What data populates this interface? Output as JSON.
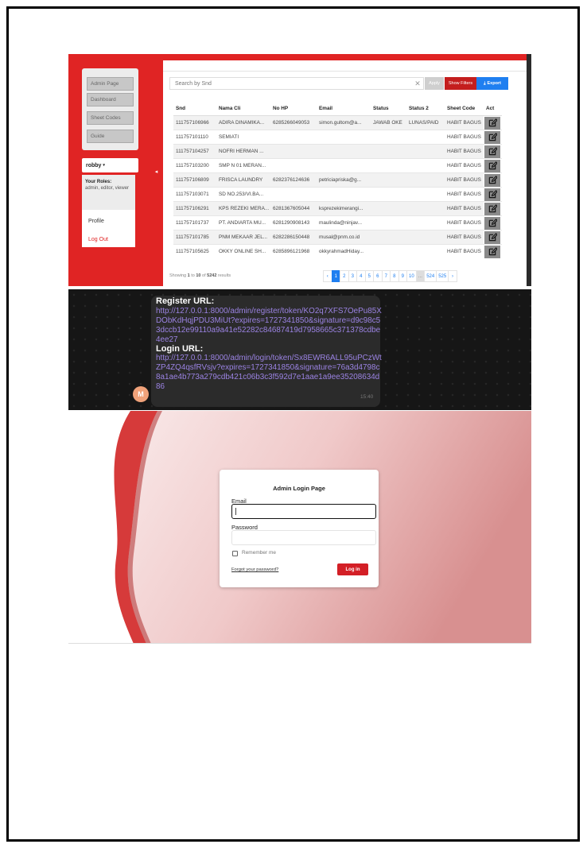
{
  "admin": {
    "sidebar": {
      "items": [
        "Admin Page",
        "Dashboard",
        "Sheet Codes",
        "Guide"
      ],
      "user": "robby",
      "user_caret": "▾",
      "roles_label": "Your Roles:",
      "roles_value": "admin, editor, viewer",
      "menu": [
        "Profile",
        "Log Out"
      ],
      "collapse_icon": "◂"
    },
    "toolbar": {
      "search_placeholder": "Search by Snd",
      "clear_icon": "✕",
      "apply": "Apply",
      "show_filters": "Show Filters",
      "export_icon": "⤓",
      "export": "Export"
    },
    "table": {
      "columns": [
        "Snd",
        "Nama Cli",
        "No HP",
        "Email",
        "Status",
        "Status 2",
        "Sheet Code",
        "Act"
      ],
      "rows": [
        [
          "111757106966",
          "ADIRA DINAMIKA...",
          "6285266049053",
          "simon.gultom@a...",
          "JAWAB OKE",
          "LUNAS/PAID",
          "HABIT BAGUS"
        ],
        [
          "111757101110",
          "SEMIATI",
          "",
          "",
          "",
          "",
          "HABIT BAGUS"
        ],
        [
          "111757104257",
          "NOFRI HERMAN ...",
          "",
          "",
          "",
          "",
          "HABIT BAGUS"
        ],
        [
          "111757103200",
          "SMP N 01 MERAN...",
          "",
          "",
          "",
          "",
          "HABIT BAGUS"
        ],
        [
          "111757106809",
          "FRISCA LAUNDRY",
          "6282376124636",
          "petriciapriska@g...",
          "",
          "",
          "HABIT BAGUS"
        ],
        [
          "111757103071",
          "SD NO.253/VI.BA...",
          "",
          "",
          "",
          "",
          "HABIT BAGUS"
        ],
        [
          "111757106291",
          "KPS REZEKI MERA...",
          "6281367605044",
          "ksprezekimerangi...",
          "",
          "",
          "HABIT BAGUS"
        ],
        [
          "111757101737",
          "PT. ANDIARTA MU...",
          "6281290908143",
          "maulinda@ninjav...",
          "",
          "",
          "HABIT BAGUS"
        ],
        [
          "111757101785",
          "PNM MEKAAR JEL...",
          "6282286150448",
          "musal@pnm.co.id",
          "",
          "",
          "HABIT BAGUS"
        ],
        [
          "111757105625",
          "OKKY ONLINE SH...",
          "6285896121968",
          "okkyrahmadHiday...",
          "",
          "",
          "HABIT BAGUS"
        ]
      ]
    },
    "footer": {
      "prefix": "Showing ",
      "from": "1",
      "to_word": " to ",
      "to": "10",
      "of_word": " of ",
      "total": "5242",
      "suffix": " results"
    },
    "pagination": [
      "‹",
      "1",
      "2",
      "3",
      "4",
      "5",
      "6",
      "7",
      "8",
      "9",
      "10",
      "...",
      "524",
      "525",
      "›"
    ],
    "current_page": "1"
  },
  "chat": {
    "register_label": "Register URL:",
    "register_url": "http://127.0.0.1:8000/admin/register/token/KO2q7XFS7OePu85XDObKdHqjPDU3MiUt?expires=1727341850&signature=d9c98c53dccb12e99110a9a41e52282c84687419d7958665c371378cdbe4ee27",
    "login_label": "Login URL:",
    "login_url": "http://127.0.0.1:8000/admin/login/token/Sx8EWR6ALL95uPCzWtZP4ZQ4qsfRVsjv?expires=1727341850&signature=76a3d4798c8a1ae4b773a279cdb421c06b3c3f592d7e1aae1a9ee35208634d86",
    "time": "15:40",
    "avatar_letter": "M"
  },
  "login": {
    "title": "Admin Login Page",
    "email_label": "Email",
    "password_label": "Password",
    "remember": "Remember me",
    "forgot": "Forgot your password?",
    "submit": "Log in"
  },
  "colors": {
    "admin_red": "#e02424",
    "primary_blue": "#1f7ff0",
    "login_button": "#d31f26",
    "chat_link": "#9b83e3"
  }
}
